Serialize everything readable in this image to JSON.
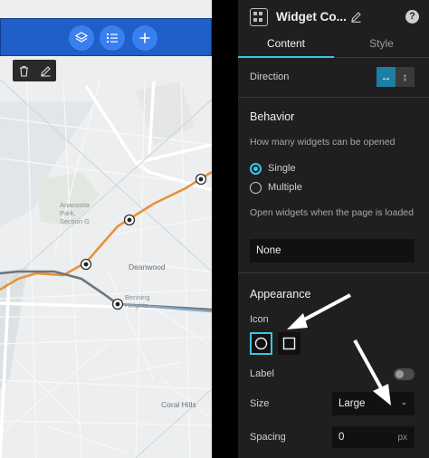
{
  "map": {
    "labels": {
      "anacostia": "Anacostia\nPark,\nSection G",
      "deanwood": "Deanwood",
      "benning": "Benning\nHeights",
      "coral_hills": "Coral Hills"
    },
    "route_colors": {
      "orange": "#e8913a",
      "gray": "#6f7479",
      "blue": "#8aa8c2"
    }
  },
  "toolbar": {
    "layers_icon": "layers-icon",
    "list_icon": "list-icon",
    "add_icon": "add-icon"
  },
  "edit_bar": {
    "delete_icon": "trash-icon",
    "edit_icon": "pencil-icon"
  },
  "panel": {
    "title": "Widget Co...",
    "tabs": [
      "Content",
      "Style"
    ],
    "active_tab": "Content",
    "accent_color": "#39c6e6",
    "direction": {
      "label": "Direction",
      "options": [
        "↔",
        "↕"
      ],
      "selected": "↔"
    },
    "behavior": {
      "title": "Behavior",
      "question": "How many widgets can be opened",
      "options": [
        "Single",
        "Multiple"
      ],
      "selected": "Single",
      "open_on_load_label": "Open widgets when the page is loaded",
      "open_on_load_value": "None"
    },
    "appearance": {
      "title": "Appearance",
      "icon_label": "Icon",
      "icon_options": [
        "circle",
        "square"
      ],
      "icon_selected": "circle",
      "label_label": "Label",
      "label_enabled": false,
      "size_label": "Size",
      "size_value": "Large",
      "spacing_label": "Spacing",
      "spacing_value": "0",
      "spacing_unit": "px"
    }
  }
}
